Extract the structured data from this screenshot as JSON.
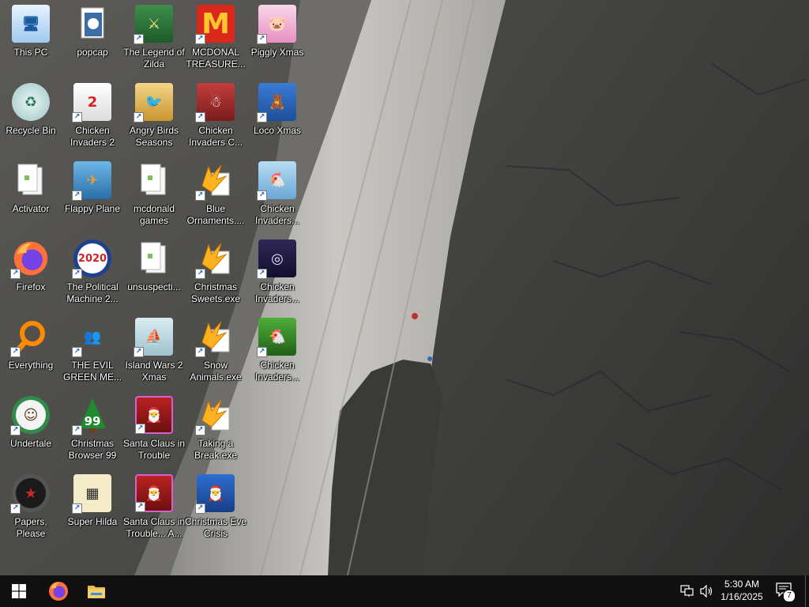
{
  "desktop": {
    "icons": [
      {
        "label": "This PC",
        "icon": "computer-icon",
        "shortcut": false
      },
      {
        "label": "popcap",
        "icon": "folder-icon",
        "shortcut": false
      },
      {
        "label": "The Legend of Zilda",
        "icon": "game-zilda-icon",
        "shortcut": true
      },
      {
        "label": "MCDONAL TREASURE...",
        "icon": "mcdonalds-icon",
        "shortcut": true
      },
      {
        "label": "Piggly Xmas",
        "icon": "piggly-icon",
        "shortcut": true
      },
      {
        "label": "Recycle Bin",
        "icon": "recycle-bin-icon",
        "shortcut": false
      },
      {
        "label": "Chicken Invaders 2",
        "icon": "chicken-icon",
        "shortcut": true
      },
      {
        "label": "Angry Birds Seasons",
        "icon": "angry-birds-icon",
        "shortcut": true
      },
      {
        "label": "Chicken Invaders C...",
        "icon": "chicken-snowman-icon",
        "shortcut": true
      },
      {
        "label": "Loco Xmas",
        "icon": "loco-bear-icon",
        "shortcut": true
      },
      {
        "label": "Activator",
        "icon": "file-icon",
        "shortcut": false
      },
      {
        "label": "Flappy Plane",
        "icon": "flappy-plane-icon",
        "shortcut": true
      },
      {
        "label": "mcdonald games",
        "icon": "file-icon",
        "shortcut": false
      },
      {
        "label": "Blue Ornaments....",
        "icon": "exe-icon",
        "shortcut": true
      },
      {
        "label": "Chicken Invaders...",
        "icon": "chicken-santa-icon",
        "shortcut": true
      },
      {
        "label": "Firefox",
        "icon": "firefox-icon",
        "shortcut": true
      },
      {
        "label": "The Political Machine 2...",
        "icon": "political-machine-icon",
        "shortcut": true
      },
      {
        "label": "unsuspecti...",
        "icon": "file-icon",
        "shortcut": false
      },
      {
        "label": "Christmas Sweets.exe",
        "icon": "exe-icon",
        "shortcut": true
      },
      {
        "label": "Chicken Invaders...",
        "icon": "chicken-eggs-icon",
        "shortcut": true
      },
      {
        "label": "Everything",
        "icon": "search-everything-icon",
        "shortcut": true
      },
      {
        "label": "THE EVIL GREEN ME...",
        "icon": "msn-icon",
        "shortcut": true
      },
      {
        "label": "Island Wars 2 Xmas",
        "icon": "island-wars-icon",
        "shortcut": true
      },
      {
        "label": "Snow Animals.exe",
        "icon": "exe-icon",
        "shortcut": true
      },
      {
        "label": "Chicken Invaders...",
        "icon": "chicken-green-icon",
        "shortcut": true
      },
      {
        "label": "Undertale",
        "icon": "undertale-icon",
        "shortcut": true
      },
      {
        "label": "Christmas Browser 99",
        "icon": "christmas-tree-icon",
        "shortcut": true
      },
      {
        "label": "Santa Claus in Trouble",
        "icon": "santa-icon",
        "shortcut": true
      },
      {
        "label": "Taking a Break.exe",
        "icon": "exe-icon",
        "shortcut": true
      },
      {
        "label": "Papers, Please",
        "icon": "papers-please-icon",
        "shortcut": true
      },
      {
        "label": "Super Hilda",
        "icon": "super-hilda-icon",
        "shortcut": true
      },
      {
        "label": "Santa Claus in Trouble... A...",
        "icon": "santa-icon",
        "shortcut": true
      },
      {
        "label": "Christmas Eve Crisis",
        "icon": "santa-crisis-icon",
        "shortcut": true
      }
    ]
  },
  "taskbar": {
    "start_icon": "windows-logo-icon",
    "pinned": [
      {
        "name": "Firefox",
        "icon": "firefox-icon"
      },
      {
        "name": "File Explorer",
        "icon": "folder-icon"
      }
    ],
    "tray": {
      "network_icon": "network-icon",
      "volume_icon": "volume-icon",
      "time": "5:30 AM",
      "date": "1/16/2025",
      "notification_count": "7"
    }
  },
  "colors": {
    "taskbar_bg": "#101010",
    "windows_blue": "#0078d7",
    "mcdonalds_red": "#da291c",
    "mcdonalds_yellow": "#ffc72c"
  }
}
